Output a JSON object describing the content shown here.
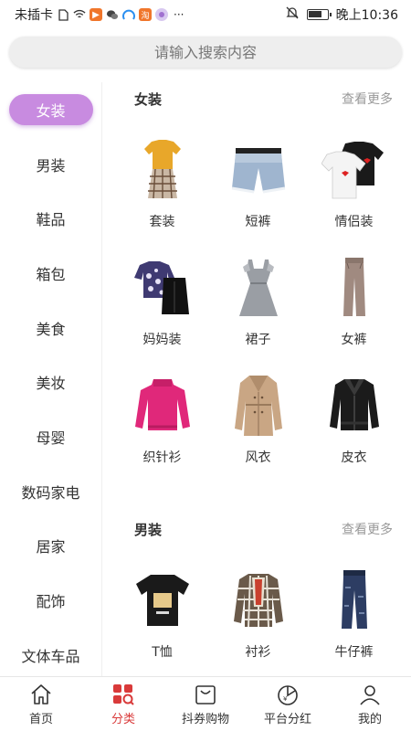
{
  "status_bar": {
    "carrier": "未插卡",
    "time": "晚上10:36",
    "more": "···",
    "icons": [
      "sim-icon",
      "wifi-icon",
      "video-app-icon",
      "wechat-icon",
      "browser-icon",
      "taobao-icon",
      "app-icon",
      "mute-icon",
      "battery-icon"
    ]
  },
  "search": {
    "placeholder": "请输入搜索内容"
  },
  "sidebar": {
    "items": [
      {
        "label": "女装",
        "active": true
      },
      {
        "label": "男装"
      },
      {
        "label": "鞋品"
      },
      {
        "label": "箱包"
      },
      {
        "label": "美食"
      },
      {
        "label": "美妆"
      },
      {
        "label": "母婴"
      },
      {
        "label": "数码家电"
      },
      {
        "label": "居家"
      },
      {
        "label": "配饰"
      },
      {
        "label": "文体车品"
      }
    ]
  },
  "sections": [
    {
      "title": "女装",
      "more": "查看更多",
      "items": [
        {
          "label": "套装",
          "icon": "outfit-set-image"
        },
        {
          "label": "短裤",
          "icon": "shorts-image"
        },
        {
          "label": "情侣装",
          "icon": "couple-tshirts-image"
        },
        {
          "label": "妈妈装",
          "icon": "mom-outfit-image"
        },
        {
          "label": "裙子",
          "icon": "dress-image"
        },
        {
          "label": "女裤",
          "icon": "womens-pants-image"
        },
        {
          "label": "织针衫",
          "icon": "sweater-image"
        },
        {
          "label": "风衣",
          "icon": "trench-coat-image"
        },
        {
          "label": "皮衣",
          "icon": "leather-jacket-image"
        }
      ]
    },
    {
      "title": "男装",
      "more": "查看更多",
      "items": [
        {
          "label": "T恤",
          "icon": "tshirt-image"
        },
        {
          "label": "衬衫",
          "icon": "plaid-shirt-image"
        },
        {
          "label": "牛仔裤",
          "icon": "jeans-image"
        }
      ]
    }
  ],
  "tabbar": {
    "tabs": [
      {
        "label": "首页",
        "icon": "home-icon"
      },
      {
        "label": "分类",
        "icon": "category-icon",
        "active": true
      },
      {
        "label": "抖券购物",
        "icon": "shopping-bag-icon"
      },
      {
        "label": "平台分红",
        "icon": "dividend-icon"
      },
      {
        "label": "我的",
        "icon": "profile-icon"
      }
    ]
  },
  "colors": {
    "accent_pill": "#c88be0",
    "active_tab": "#d93a3a",
    "more_text": "#999999"
  }
}
